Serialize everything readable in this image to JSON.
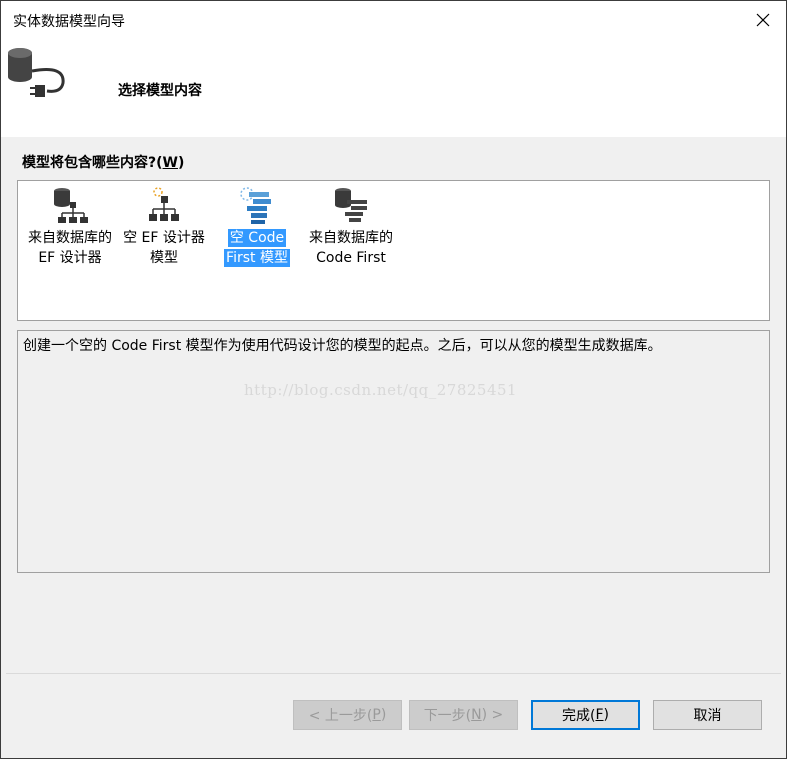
{
  "window": {
    "title": "实体数据模型向导",
    "close_glyph": "✕"
  },
  "header": {
    "title": "选择模型内容",
    "icon": "database-connect-icon"
  },
  "question": {
    "prefix": "模型将包含哪些内容?(",
    "hotkey": "W",
    "suffix": ")"
  },
  "models": [
    {
      "line1": "来自数据库的",
      "line2": "EF 设计器",
      "icon": "db-hierarchy-icon",
      "selected": false
    },
    {
      "line1": "空 EF 设计器",
      "line2": "模型",
      "icon": "empty-hierarchy-icon",
      "selected": false
    },
    {
      "line1": "空 Code",
      "line2": "First 模型",
      "icon": "code-first-icon",
      "selected": true
    },
    {
      "line1": "来自数据库的",
      "line2": "Code First",
      "icon": "db-code-icon",
      "selected": false
    }
  ],
  "description": {
    "text": "创建一个空的 Code First 模型作为使用代码设计您的模型的起点。之后，可以从您的模型生成数据库。",
    "watermark": "http://blog.csdn.net/qq_27825451"
  },
  "buttons": {
    "prev": {
      "pre": "< 上一步(",
      "key": "P",
      "post": ")",
      "enabled": false
    },
    "next": {
      "pre": "下一步(",
      "key": "N",
      "post": ") >",
      "enabled": false
    },
    "finish": {
      "pre": "完成(",
      "key": "F",
      "post": ")",
      "enabled": true
    },
    "cancel": {
      "label": "取消",
      "enabled": true
    }
  },
  "colors": {
    "selection": "#3399ff",
    "default_button_border": "#0078d7",
    "panel_background": "#f0f0f0"
  }
}
